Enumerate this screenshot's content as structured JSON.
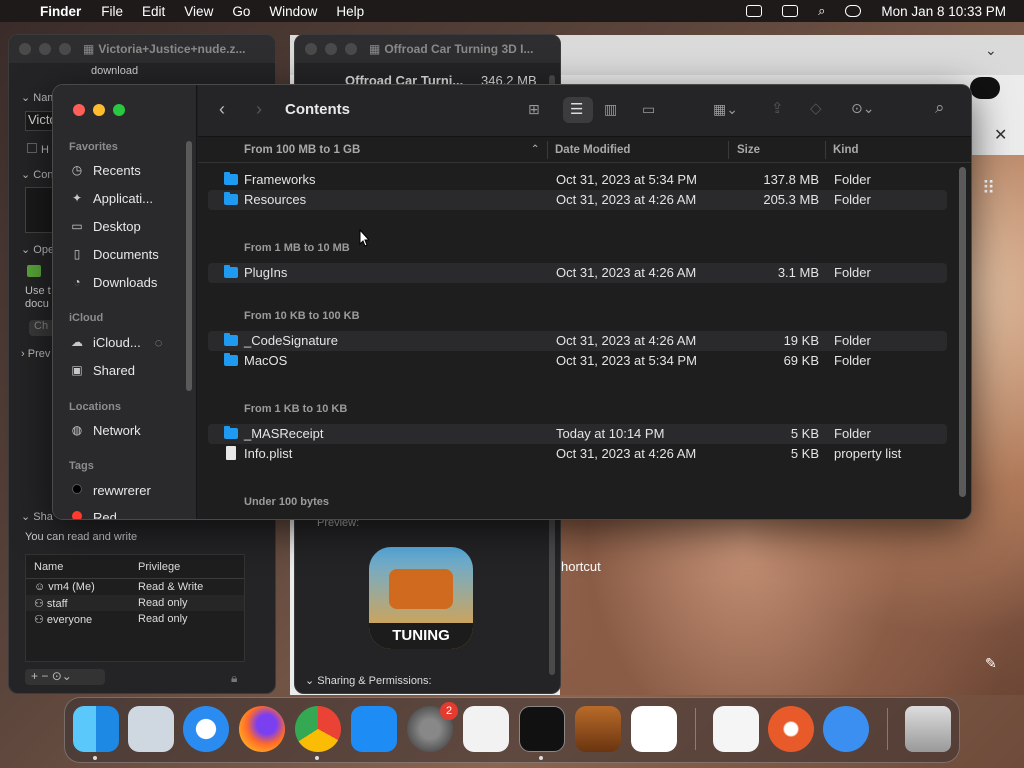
{
  "menubar": {
    "app_name": "Finder",
    "items": [
      "File",
      "Edit",
      "View",
      "Go",
      "Window",
      "Help"
    ],
    "datetime": "Mon Jan 8  10:33 PM"
  },
  "bg_window_left": {
    "title": "Victoria+Justice+nude.z...",
    "subtitle": "download",
    "name_label": "Nam",
    "name_value": "Victo",
    "check_label": "H",
    "section_comments": "Con",
    "section_open": "Ope",
    "open_text_1": "Use t",
    "open_text_2": "docu",
    "change_btn": "Ch",
    "section_preview": "Prev",
    "section_sharing": "Sha",
    "sharing_note": "You can read and write",
    "perm_headers": [
      "Name",
      "Privilege"
    ],
    "permissions": [
      {
        "name": "vm4 (Me)",
        "privilege": "Read & Write"
      },
      {
        "name": "staff",
        "privilege": "Read only"
      },
      {
        "name": "everyone",
        "privilege": "Read only"
      }
    ]
  },
  "bg_window_right": {
    "title": "Offroad Car Turning 3D I...",
    "app_name": "Offroad Car Turni...",
    "size": "346.2 MB",
    "preview_label": "Preview:",
    "app_badge_text": "TUNING",
    "sharing_label": "Sharing & Permissions:"
  },
  "browser": {
    "shortcut_text": "hortcut"
  },
  "finder": {
    "title": "Contents",
    "sidebar": {
      "favorites_header": "Favorites",
      "favorites": [
        {
          "label": "Recents",
          "icon": "clock-icon"
        },
        {
          "label": "Applicati...",
          "icon": "applications-icon"
        },
        {
          "label": "Desktop",
          "icon": "desktop-icon"
        },
        {
          "label": "Documents",
          "icon": "document-icon"
        },
        {
          "label": "Downloads",
          "icon": "download-icon"
        }
      ],
      "icloud_header": "iCloud",
      "icloud": [
        {
          "label": "iCloud...",
          "icon": "cloud-icon"
        },
        {
          "label": "Shared",
          "icon": "shared-folder-icon"
        }
      ],
      "locations_header": "Locations",
      "locations": [
        {
          "label": "Network",
          "icon": "globe-icon"
        }
      ],
      "tags_header": "Tags",
      "tags": [
        {
          "label": "rewwrerer",
          "color": "#000000"
        },
        {
          "label": "Red",
          "color": "#ff3b30"
        }
      ]
    },
    "columns": {
      "name": "From 100 MB to 1 GB",
      "date": "Date Modified",
      "size": "Size",
      "kind": "Kind"
    },
    "groups": [
      {
        "label": "From 100 MB to 1 GB",
        "rows": [
          {
            "name": "Frameworks",
            "date": "Oct 31, 2023 at 5:34 PM",
            "size": "137.8 MB",
            "kind": "Folder"
          },
          {
            "name": "Resources",
            "date": "Oct 31, 2023 at 4:26 AM",
            "size": "205.3 MB",
            "kind": "Folder"
          }
        ]
      },
      {
        "label": "From 1 MB to 10 MB",
        "rows": [
          {
            "name": "PlugIns",
            "date": "Oct 31, 2023 at 4:26 AM",
            "size": "3.1 MB",
            "kind": "Folder"
          }
        ]
      },
      {
        "label": "From 10 KB to 100 KB",
        "rows": [
          {
            "name": "_CodeSignature",
            "date": "Oct 31, 2023 at 4:26 AM",
            "size": "19 KB",
            "kind": "Folder"
          },
          {
            "name": "MacOS",
            "date": "Oct 31, 2023 at 5:34 PM",
            "size": "69 KB",
            "kind": "Folder"
          }
        ]
      },
      {
        "label": "From 1 KB to 10 KB",
        "rows": [
          {
            "name": "_MASReceipt",
            "date": "Today at 10:14 PM",
            "size": "5 KB",
            "kind": "Folder"
          },
          {
            "name": "Info.plist",
            "date": "Oct 31, 2023 at 4:26 AM",
            "size": "5 KB",
            "kind": "property list"
          }
        ]
      },
      {
        "label": "Under 100 bytes",
        "rows": []
      }
    ]
  },
  "dock": {
    "settings_badge": "2",
    "apps": [
      "Finder",
      "Launchpad",
      "Safari",
      "Firefox",
      "Chrome",
      "App Store",
      "System Settings",
      "TextEdit",
      "Terminal",
      "GarageBand",
      "Visual Studio Code",
      "iMovie",
      "Instruments",
      "Alien",
      "Trash"
    ]
  }
}
